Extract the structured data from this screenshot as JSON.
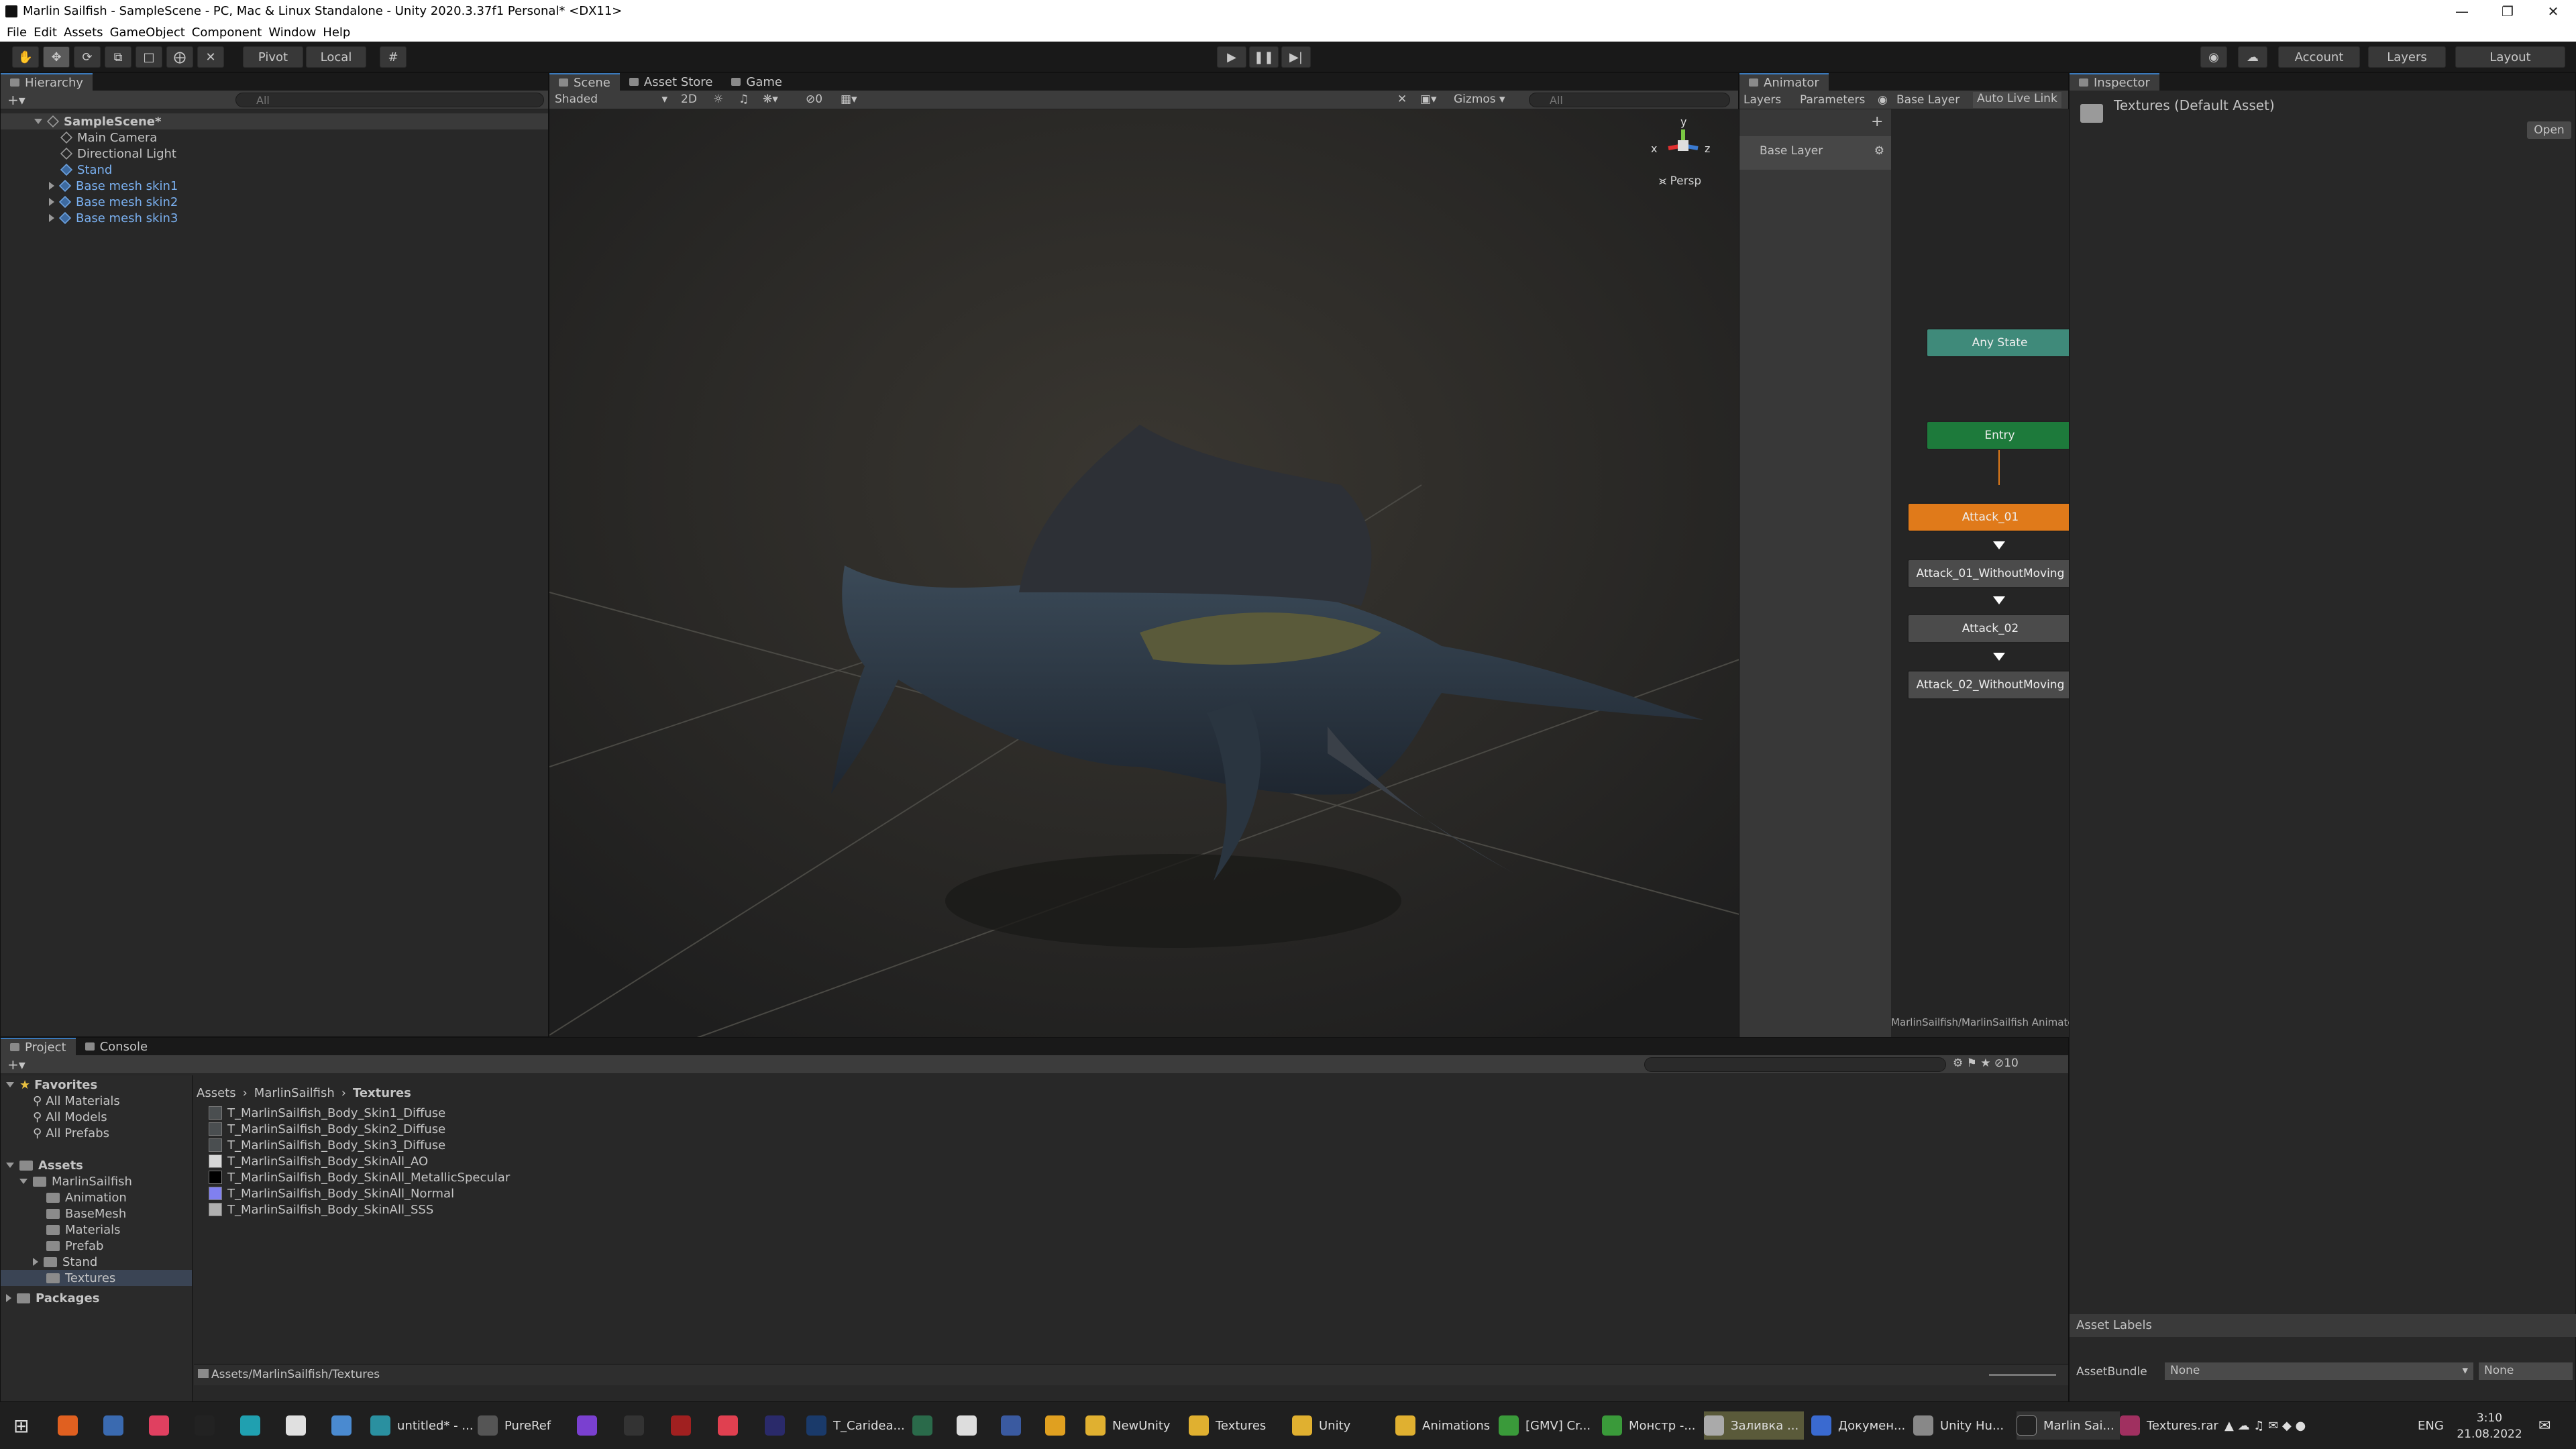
{
  "window": {
    "title": "Marlin Sailfish - SampleScene - PC, Mac & Linux Standalone - Unity 2020.3.37f1 Personal* <DX11>"
  },
  "menu": [
    "File",
    "Edit",
    "Assets",
    "GameObject",
    "Component",
    "Window",
    "Help"
  ],
  "toolbar": {
    "pivot": "Pivot",
    "local": "Local",
    "account": "Account",
    "layers": "Layers",
    "layout": "Layout"
  },
  "hierarchy": {
    "tab": "Hierarchy",
    "search_placeholder": "All",
    "scene": "SampleScene*",
    "items": [
      "Main Camera",
      "Directional Light",
      "Stand",
      "Base mesh skin1",
      "Base mesh skin2",
      "Base mesh skin3"
    ]
  },
  "scene_view": {
    "tabs": [
      "Scene",
      "Asset Store",
      "Game"
    ],
    "shading": "Shaded",
    "mode_2d": "2D",
    "fx_count": "0",
    "gizmos": "Gizmos",
    "search_placeholder": "All",
    "persp": "Persp",
    "gizmo_x": "x",
    "gizmo_y": "y",
    "gizmo_z": "z"
  },
  "animator": {
    "tab": "Animator",
    "sub_tabs": [
      "Layers",
      "Parameters"
    ],
    "layer_breadcrumb": "Base Layer",
    "live_link": "Auto Live Link",
    "layer_item": "Base Layer",
    "nodes": [
      "Any State",
      "Entry",
      "Attack_01",
      "Attack_01_WithoutMoving",
      "Attack_02",
      "Attack_02_WithoutMoving"
    ],
    "path": "MarlinSailfish/MarlinSailfish Animator",
    "colors": {
      "any": "#3f8a7a",
      "entry": "#1d7a3b",
      "default": "#e07a1a",
      "state": "#4b4b4b"
    }
  },
  "inspector": {
    "tab": "Inspector",
    "asset_title": "Textures (Default Asset)",
    "open": "Open",
    "asset_labels": "Asset Labels",
    "asset_bundle_label": "AssetBundle",
    "asset_bundle_value": "None",
    "variant_value": "None"
  },
  "project": {
    "tabs": [
      "Project",
      "Console"
    ],
    "favorites": "Favorites",
    "fav_items": [
      "All Materials",
      "All Models",
      "All Prefabs"
    ],
    "assets": "Assets",
    "tree": [
      "MarlinSailfish",
      "Animation",
      "BaseMesh",
      "Materials",
      "Prefab",
      "Stand",
      "Textures"
    ],
    "packages": "Packages",
    "breadcrumb": [
      "Assets",
      "MarlinSailfish",
      "Textures"
    ],
    "files": [
      "T_MarlinSailfish_Body_Skin1_Diffuse",
      "T_MarlinSailfish_Body_Skin2_Diffuse",
      "T_MarlinSailfish_Body_Skin3_Diffuse",
      "T_MarlinSailfish_Body_SkinAll_AO",
      "T_MarlinSailfish_Body_SkinAll_MetallicSpecular",
      "T_MarlinSailfish_Body_SkinAll_Normal",
      "T_MarlinSailfish_Body_SkinAll_SSS"
    ],
    "footer_path": "Assets/MarlinSailfish/Textures",
    "hidden_count": "10"
  },
  "taskbar": {
    "items": [
      "untitled* - ...",
      "PureRef",
      "T_Caridea...",
      "NewUnity",
      "Textures",
      "Unity",
      "Animations",
      "[GMV] Cr...",
      "Монстр -...",
      "Заливка ...",
      "Докумен...",
      "Unity Hu...",
      "Marlin Sai...",
      "Textures.rar"
    ],
    "lang": "ENG",
    "time": "3:10",
    "date": "21.08.2022"
  }
}
